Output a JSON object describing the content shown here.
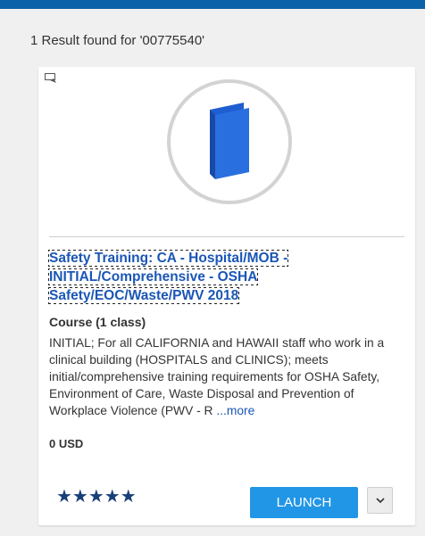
{
  "results": {
    "count_text": "1 Result found for '00775540'"
  },
  "card": {
    "type_icon": "presentation-icon",
    "thumbnail_icon": "book-icon",
    "title": "Safety Training: CA - Hospital/MOB - INITIAL/Comprehensive - OSHA Safety/EOC/Waste/PWV 2018",
    "course_type": "Course (1 class)",
    "description": "INITIAL; For all CALIFORNIA and HAWAII staff who work in a clinical building (HOSPITALS and CLINICS); meets initial/comprehensive training requirements for OSHA Safety, Environment of Care, Waste Disposal and Prevention of Workplace Violence (PWV - R",
    "more_label": "...more",
    "price": "0 USD",
    "rating": {
      "stars_text": "★★★★★",
      "value": 5,
      "max": 5
    },
    "launch_label": "LAUNCH",
    "dropdown_icon": "chevron-down-icon"
  },
  "colors": {
    "top_bar": "#0a62a8",
    "title_link": "#1a56b6",
    "launch_button": "#2196e6",
    "stars": "#1a3e78",
    "book_icon": "#1f5ed1"
  }
}
